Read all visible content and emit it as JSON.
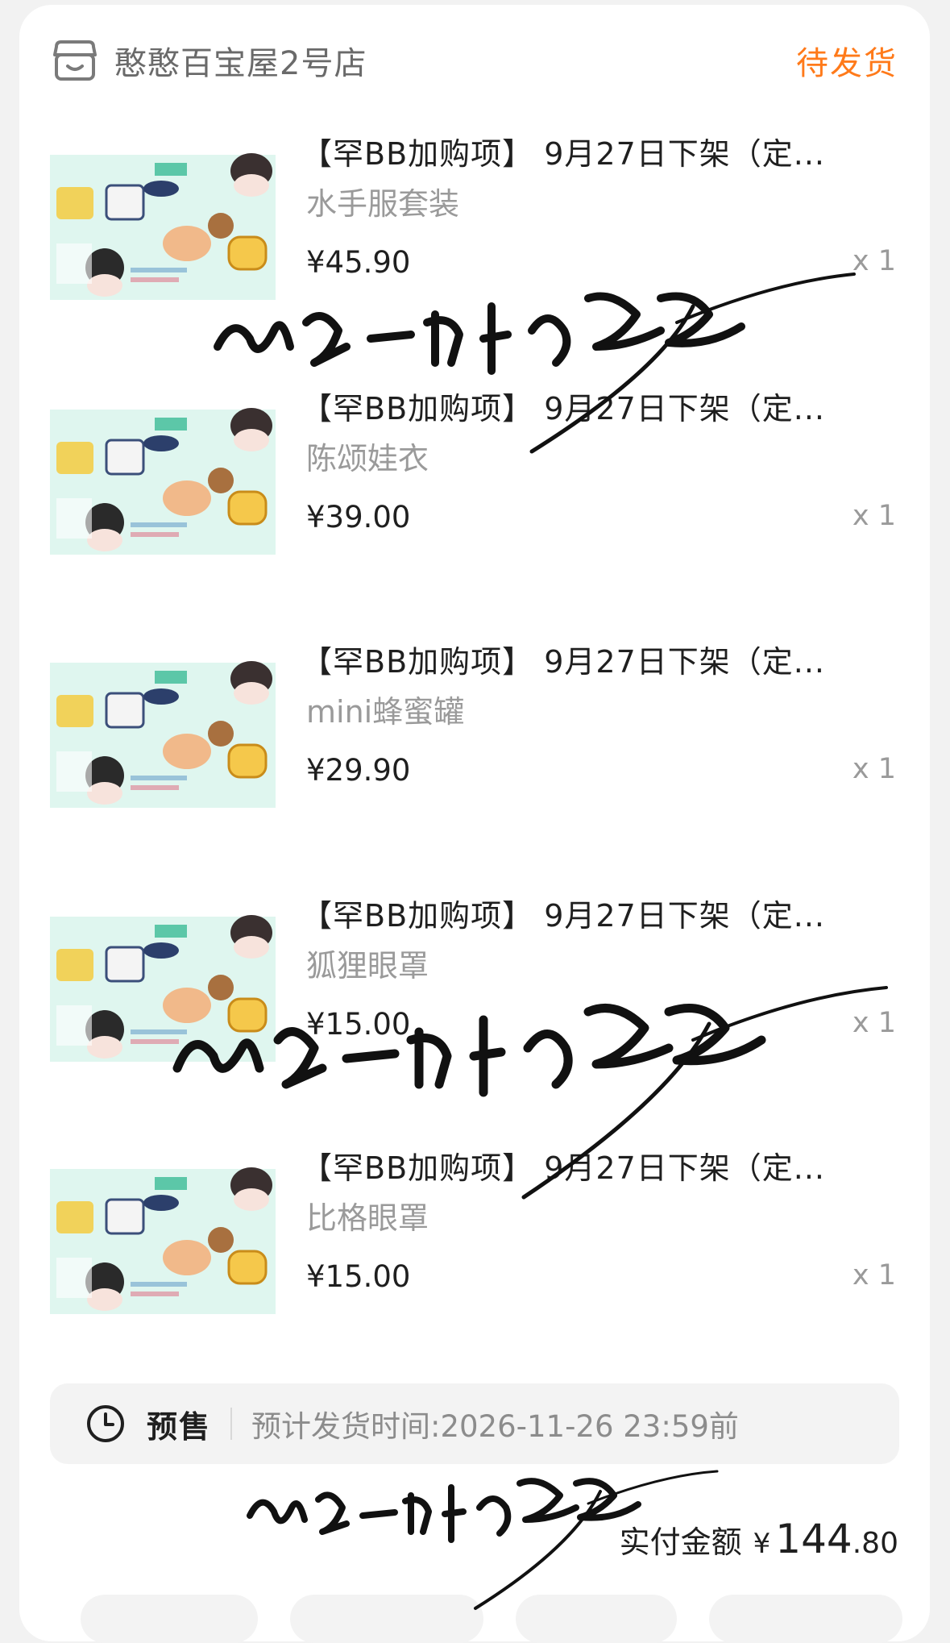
{
  "shop": {
    "name": "憨憨百宝屋2号店",
    "icon": "shop-icon"
  },
  "order_status": "待发货",
  "items": [
    {
      "title": "【罕BB加购项】 9月27日下架（定...",
      "sku": "水手服套装",
      "price": "¥45.90",
      "qty": "x 1"
    },
    {
      "title": "【罕BB加购项】 9月27日下架（定...",
      "sku": "陈颂娃衣",
      "price": "¥39.00",
      "qty": "x 1"
    },
    {
      "title": "【罕BB加购项】 9月27日下架（定...",
      "sku": "mini蜂蜜罐",
      "price": "¥29.90",
      "qty": "x 1"
    },
    {
      "title": "【罕BB加购项】 9月27日下架（定...",
      "sku": "狐狸眼罩",
      "price": "¥15.00",
      "qty": "x 1"
    },
    {
      "title": "【罕BB加购项】 9月27日下架（定...",
      "sku": "比格眼罩",
      "price": "¥15.00",
      "qty": "x 1"
    }
  ],
  "presale": {
    "label": "预售",
    "text": "预计发货时间:2026-11-26 23:59前"
  },
  "total": {
    "label": "实付金额",
    "symbol": "¥",
    "integer": "144",
    "decimal": ".80"
  },
  "colors": {
    "accent": "#ff7a1a",
    "text": "#1f1f1f",
    "muted": "#9a9a9a"
  }
}
